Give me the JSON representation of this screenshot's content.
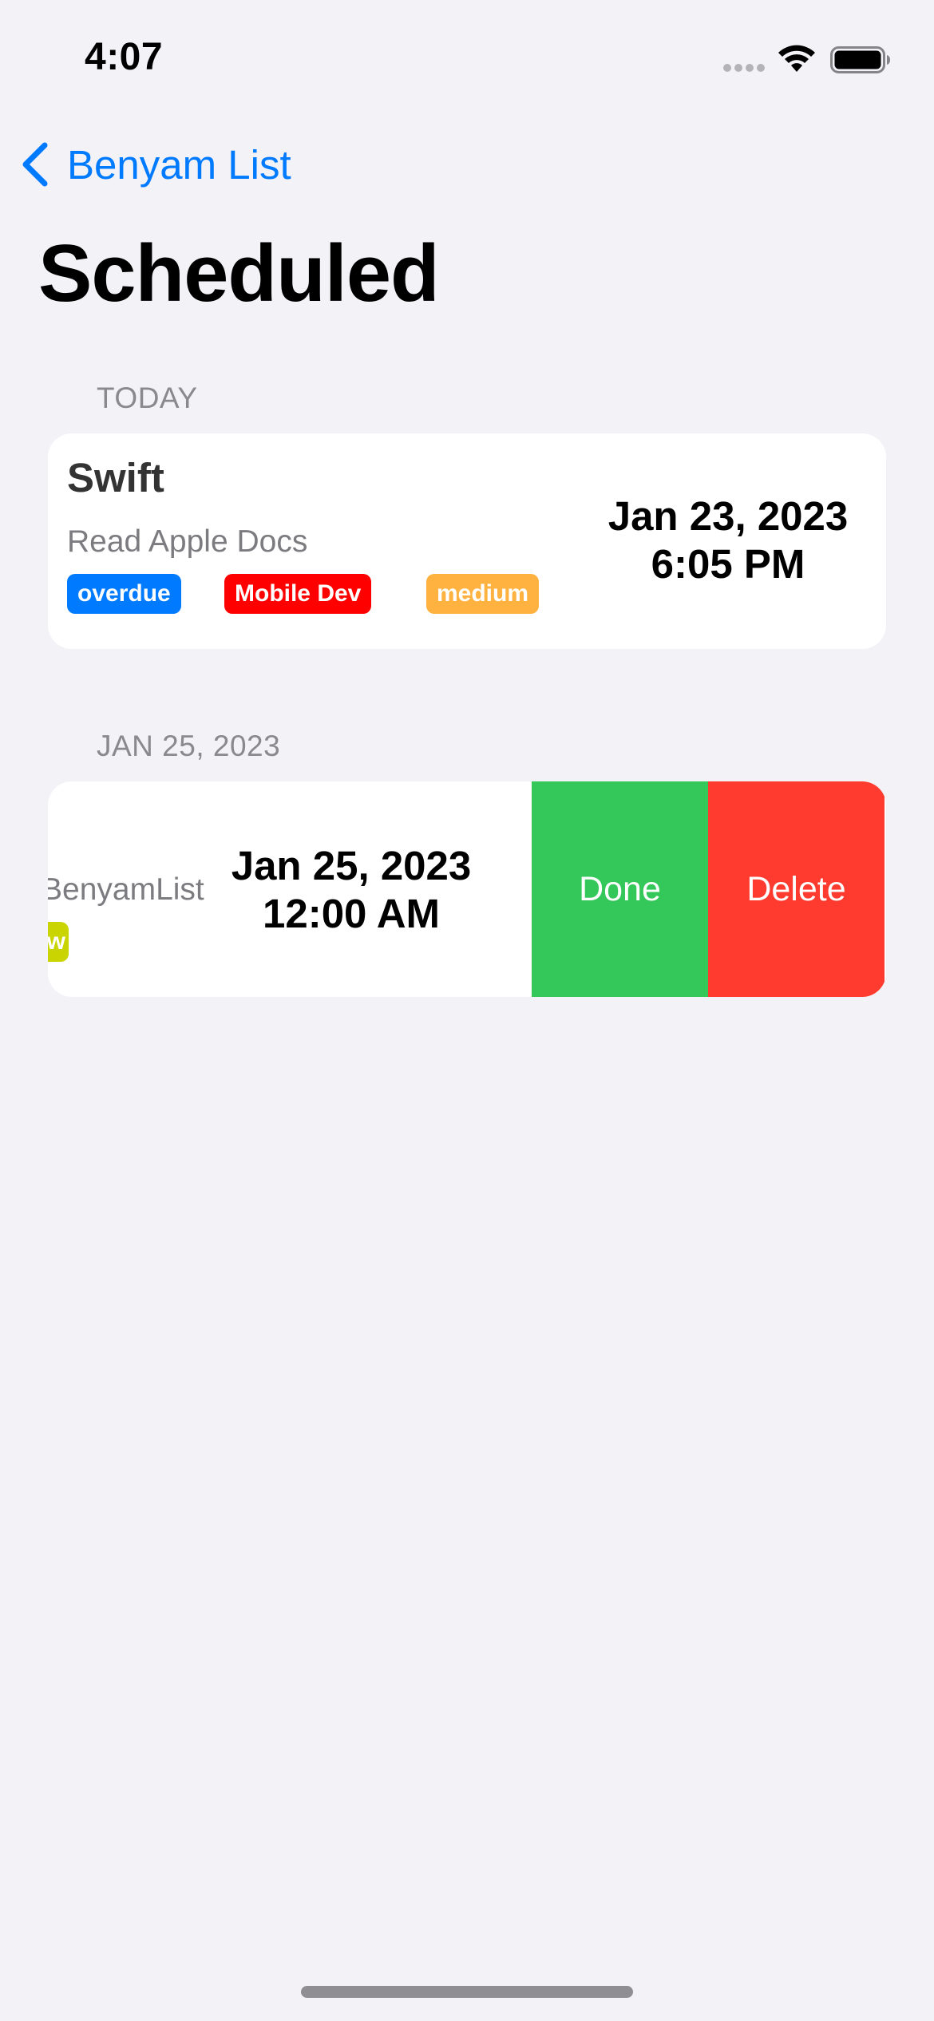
{
  "status_bar": {
    "time": "4:07"
  },
  "nav": {
    "back_label": "Benyam List"
  },
  "page_title": "Scheduled",
  "sections": [
    {
      "header": "TODAY",
      "task": {
        "title": "Swift",
        "notes": "Read Apple Docs",
        "tags": [
          {
            "label": "overdue",
            "color": "#007aff"
          },
          {
            "label": "Mobile Dev",
            "color": "#ff0000"
          },
          {
            "label": "medium",
            "color": "#ffb23f"
          }
        ],
        "date": "Jan 23, 2023",
        "time": "6:05 PM"
      }
    },
    {
      "header": "JAN 25, 2023",
      "task": {
        "notes_visible": "BenyamList",
        "tag_visible": "w",
        "tag_color": "#c9d400",
        "date": "Jan 25, 2023",
        "time": "12:00 AM",
        "swipe_actions": [
          {
            "label": "Done",
            "color": "#34c759"
          },
          {
            "label": "Delete",
            "color": "#ff3b30"
          }
        ]
      }
    }
  ],
  "colors": {
    "accent": "#007aff",
    "background": "#f2f2f7"
  }
}
